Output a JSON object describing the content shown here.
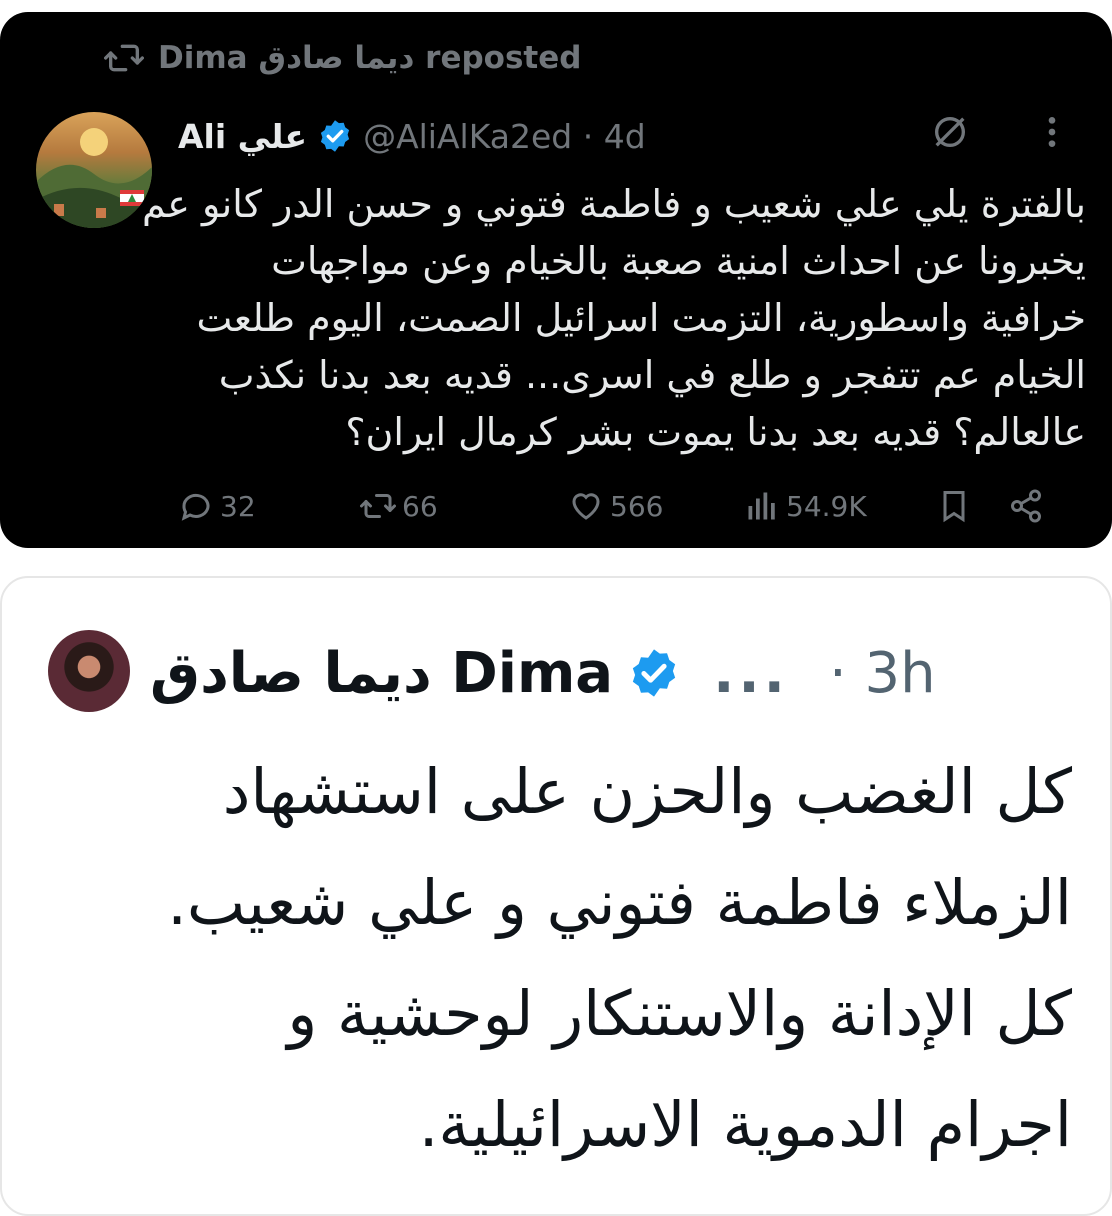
{
  "reposted_tweet": {
    "repost_label": "Dima ديما صادق reposted",
    "author_name": "Ali علي",
    "author_handle": "@AliAlKa2ed · 4d",
    "text": "بالفترة يلي علي شعيب و فاطمة فتوني و حسن الدر كانو عم\nيخبرونا عن احداث امنية صعبة بالخيام وعن مواجهات\nخرافية واسطورية، التزمت اسرائيل الصمت، اليوم طلعت\nالخيام عم تتفجر و طلع في اسرى... قديه بعد بدنا نكذب\nعالعالم؟ قديه بعد بدنا يموت بشر كرمال ايران؟",
    "stats": {
      "replies": "32",
      "reposts": "66",
      "likes": "566",
      "views": "54.9K"
    },
    "icons": [
      "repost-icon",
      "verified-badge-icon",
      "grok-icon",
      "more-icon",
      "reply-icon",
      "like-icon",
      "views-icon",
      "bookmark-icon",
      "share-icon"
    ]
  },
  "main_tweet": {
    "author_name": "ديما صادق Dima",
    "more": "...",
    "time": "· 3h",
    "text": "كل الغضب والحزن على استشهاد\nالزملاء فاطمة فتوني و علي شعيب.\nكل الإدانة والاستنكار لوحشية و\nاجرام الدموية الاسرائيلية."
  },
  "colors": {
    "dark_bg": "#000000",
    "muted_dark": "#71767b",
    "verified": "#1d9bf0",
    "text_dark": "#e7e9ea",
    "text_light": "#0f1419"
  }
}
